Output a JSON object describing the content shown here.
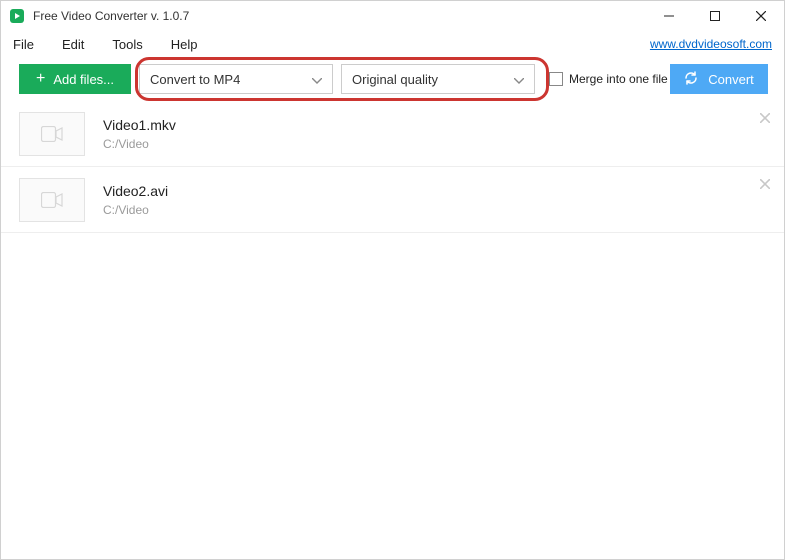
{
  "window": {
    "title": "Free Video Converter v. 1.0.7"
  },
  "menubar": {
    "items": [
      "File",
      "Edit",
      "Tools",
      "Help"
    ],
    "link": "www.dvdvideosoft.com"
  },
  "toolbar": {
    "add_label": "Add files...",
    "format_value": "Convert to MP4",
    "quality_value": "Original quality",
    "merge_label": "Merge into one file",
    "convert_label": "Convert"
  },
  "files": [
    {
      "name": "Video1.mkv",
      "path": "C:/Video"
    },
    {
      "name": "Video2.avi",
      "path": "C:/Video"
    }
  ],
  "colors": {
    "accent_green": "#1aab5a",
    "accent_blue": "#4ea9f5",
    "highlight_red": "#cc3530"
  }
}
